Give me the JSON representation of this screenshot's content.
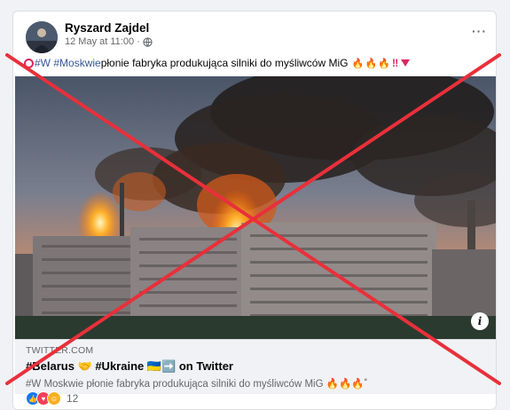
{
  "post": {
    "author": "Ryszard Zajdel",
    "timestamp": "12 May at 11:00",
    "separator": "·",
    "more_label": "···",
    "text_hashtag_1": "#W",
    "text_hashtag_2": "#Moskwie",
    "text_body": " płonie fabryka produkująca silniki do myśliwców MiG",
    "text_suffix": "‼"
  },
  "image": {
    "info_label": "i"
  },
  "link_preview": {
    "domain": "TWITTER.COM",
    "title": "#Belarus 🤝 #Ukraine 🇺🇦➡️ on Twitter",
    "description": "#W Moskwie płonie fabryka produkująca silniki do myśliwców MiG 🔥🔥🔥˚"
  },
  "reactions": {
    "count": "12",
    "types": [
      "like-icon",
      "love-icon",
      "haha-icon"
    ]
  },
  "colors": {
    "link_blue": "#385898",
    "overlay_red": "#e8303a",
    "fire_orange": "#f06a1d"
  }
}
